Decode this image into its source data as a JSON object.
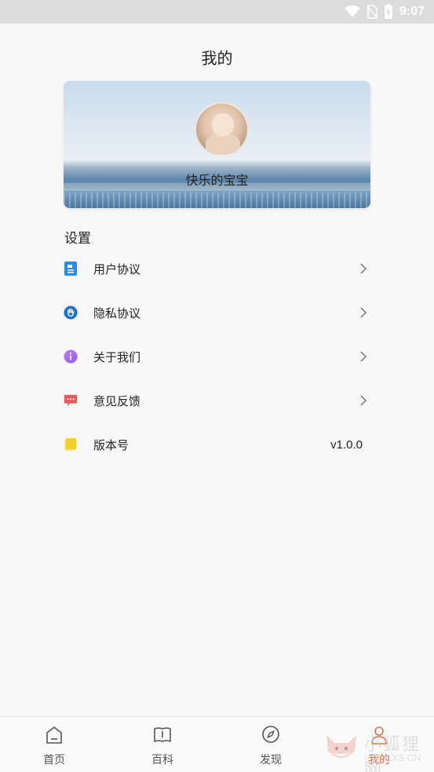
{
  "status_bar": {
    "time": "9:07",
    "icons": [
      "wifi-icon",
      "no-sim-icon",
      "battery-icon"
    ]
  },
  "header": {
    "title": "我的"
  },
  "profile": {
    "username": "快乐的宝宝"
  },
  "settings": {
    "section_title": "设置",
    "items": [
      {
        "label": "用户协议",
        "icon": "document-icon",
        "icon_color": "#2d8ae6",
        "has_chevron": true
      },
      {
        "label": "隐私协议",
        "icon": "hand-shield-icon",
        "icon_color": "#1f6fd1",
        "has_chevron": true
      },
      {
        "label": "关于我们",
        "icon": "info-icon",
        "icon_color": "#a96ff0",
        "has_chevron": true
      },
      {
        "label": "意见反馈",
        "icon": "feedback-bubble-icon",
        "icon_color": "#ea5a5a",
        "has_chevron": true
      },
      {
        "label": "版本号",
        "icon": "note-icon",
        "icon_color": "#f2cf2c",
        "value": "v1.0.0"
      }
    ]
  },
  "tab_bar": {
    "tabs": [
      {
        "label": "首页",
        "icon": "home-icon",
        "active": false
      },
      {
        "label": "百科",
        "icon": "book-icon",
        "active": false
      },
      {
        "label": "发现",
        "icon": "compass-icon",
        "active": false
      },
      {
        "label": "我的",
        "icon": "user-icon",
        "active": true
      }
    ],
    "active_color": "#e4734a"
  },
  "watermark": {
    "text": "小狐狸网",
    "url": "XHLXS.CN"
  }
}
